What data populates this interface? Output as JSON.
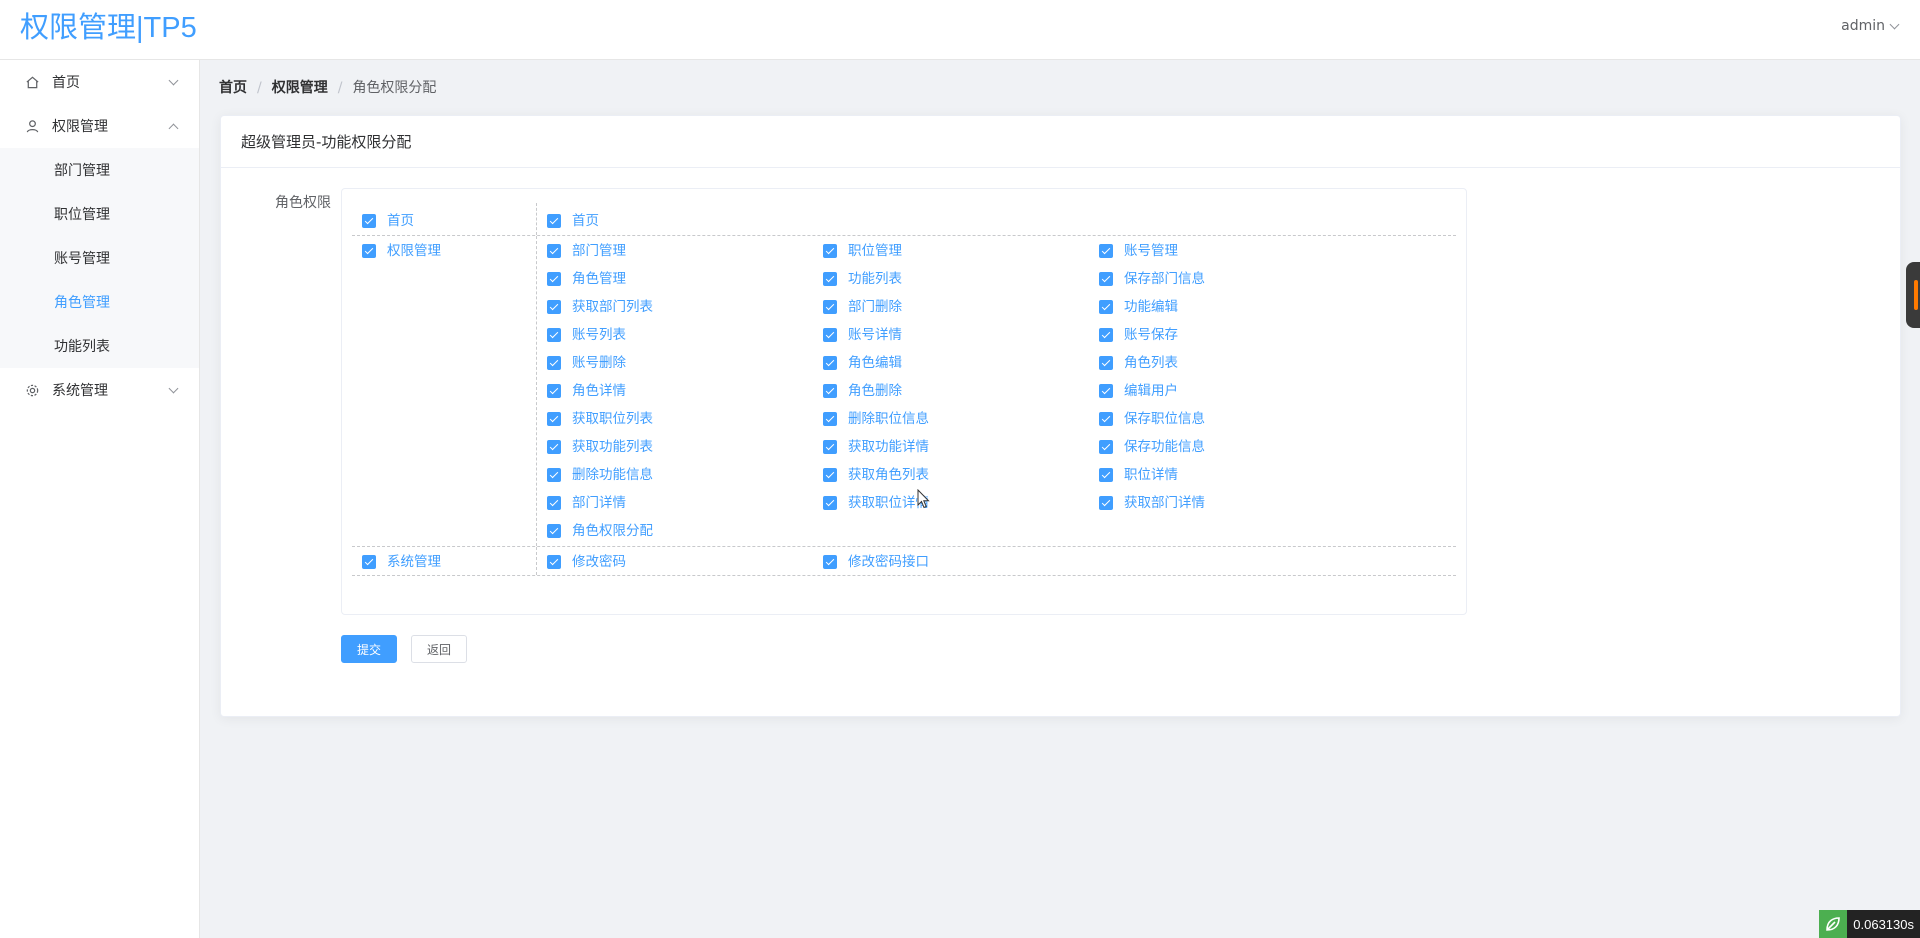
{
  "header": {
    "logo": "权限管理|TP5",
    "user": "admin"
  },
  "sidebar": {
    "home": "首页",
    "permission": "权限管理",
    "sub_items": [
      "部门管理",
      "职位管理",
      "账号管理",
      "角色管理",
      "功能列表"
    ],
    "system": "系统管理"
  },
  "breadcrumb": [
    "首页",
    "权限管理",
    "角色权限分配"
  ],
  "card": {
    "title": "超级管理员-功能权限分配",
    "form_label": "角色权限"
  },
  "permissions": {
    "row1": {
      "parent": "首页",
      "children": [
        "首页"
      ]
    },
    "row2": {
      "parent": "权限管理",
      "children": [
        "部门管理",
        "职位管理",
        "账号管理",
        "角色管理",
        "功能列表",
        "保存部门信息",
        "获取部门列表",
        "部门删除",
        "功能编辑",
        "账号列表",
        "账号详情",
        "账号保存",
        "账号删除",
        "角色编辑",
        "角色列表",
        "角色详情",
        "角色删除",
        "编辑用户",
        "获取职位列表",
        "删除职位信息",
        "保存职位信息",
        "获取功能列表",
        "获取功能详情",
        "保存功能信息",
        "删除功能信息",
        "获取角色列表",
        "职位详情",
        "部门详情",
        "获取职位详情",
        "获取部门详情",
        "角色权限分配"
      ]
    },
    "row3": {
      "parent": "系统管理",
      "children": [
        "修改密码",
        "修改密码接口"
      ]
    }
  },
  "buttons": {
    "submit": "提交",
    "back": "返回"
  },
  "timer": "0.063130s",
  "colors": {
    "primary": "#409eff",
    "background": "#f0f2f5"
  }
}
